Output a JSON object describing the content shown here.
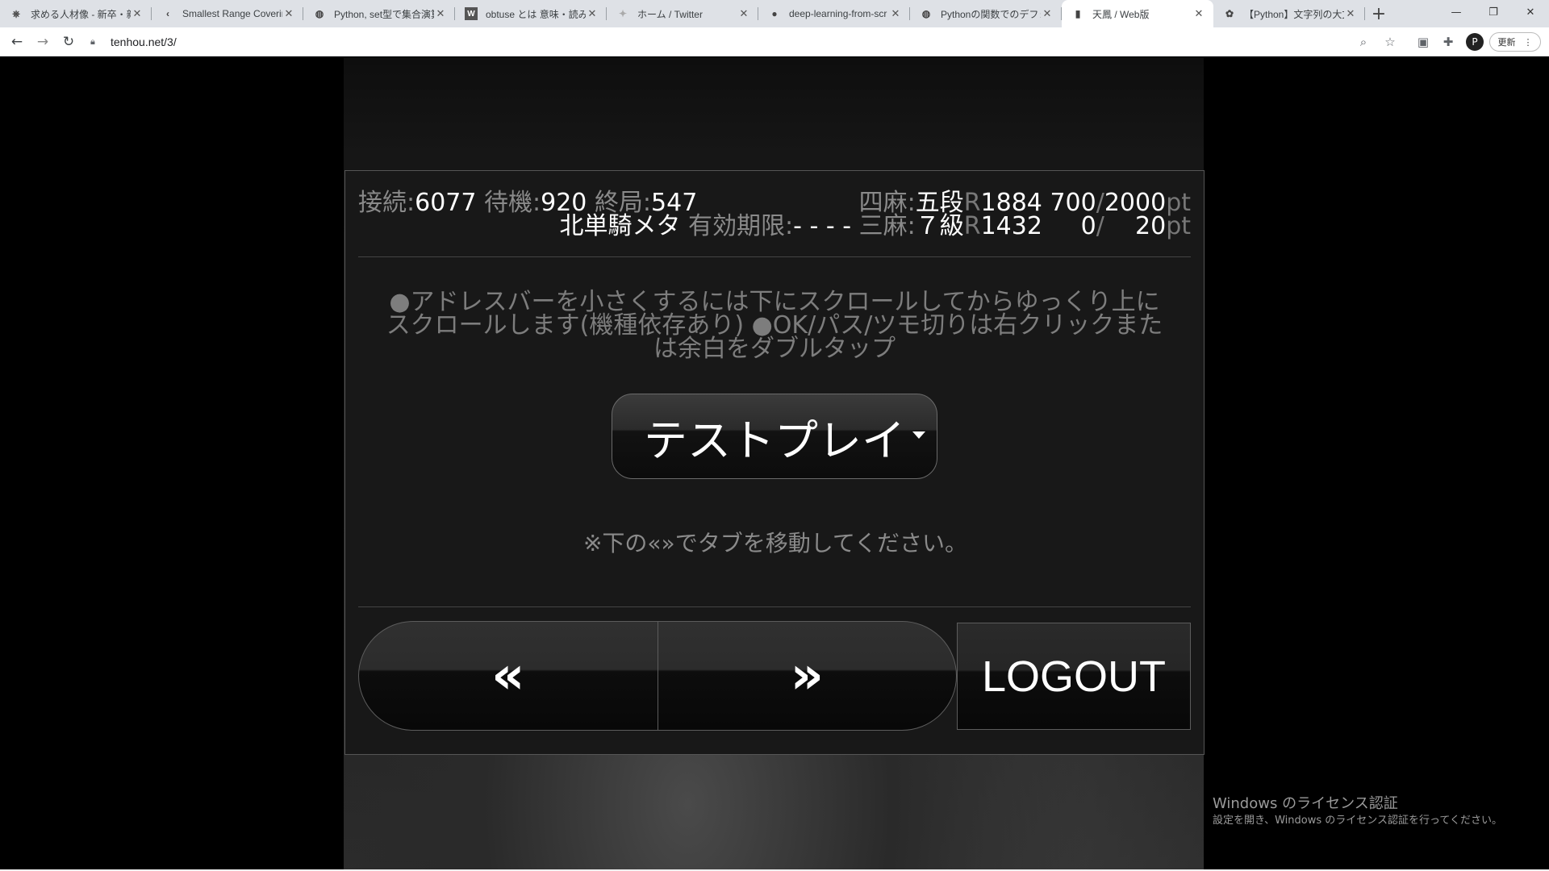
{
  "browser": {
    "tabs": [
      {
        "title": "求める人材像 - 新卒・新",
        "icon": "helm-icon"
      },
      {
        "title": "Smallest Range Coverin",
        "icon": "leetcode-icon"
      },
      {
        "title": "Python, set型で集合演算",
        "icon": "globe-icon"
      },
      {
        "title": "obtuse とは 意味・読み方",
        "icon": "weblio-icon"
      },
      {
        "title": "ホーム / Twitter",
        "icon": "twitter-icon"
      },
      {
        "title": "deep-learning-from-scr",
        "icon": "github-icon"
      },
      {
        "title": "Pythonの関数でのデフォル",
        "icon": "globe-icon"
      },
      {
        "title": "天鳳 / Web版",
        "icon": "tenhou-icon",
        "active": true
      },
      {
        "title": "【Python】文字列の大文",
        "icon": "openai-icon"
      }
    ],
    "new_tab": "+",
    "url": "tenhou.net/3/",
    "update_label": "更新",
    "avatar_letter": "P"
  },
  "stats": {
    "connect_label": "接続:",
    "connect_value": "6077",
    "waiting_label": "待機:",
    "waiting_value": "920",
    "finished_label": "終局:",
    "finished_value": "547",
    "username": "北単騎メタ",
    "expiry_label": "有効期限:",
    "expiry_value": "- - - -",
    "yonma_label": "四麻:",
    "yonma_rank": "五段",
    "yonma_r": "R",
    "yonma_rating": "1884",
    "yonma_points": "700",
    "yonma_slash": "/",
    "yonma_max": "2000",
    "yonma_unit": "pt",
    "sanma_label": "三麻:",
    "sanma_rank": "７級",
    "sanma_r": "R",
    "sanma_rating": "1432",
    "sanma_points": "0",
    "sanma_slash": "/",
    "sanma_max": "20",
    "sanma_unit": "pt"
  },
  "notice_text": "●アドレスバーを小さくするには下にスクロールしてからゆっくり上にスクロールします(機種依存あり) ●OK/パス/ツモ切りは右クリックまたは余白をダブルタップ",
  "play_button_label": "テストプレイ",
  "hint_text": "※下の«»でタブを移動してください。",
  "nav": {
    "prev": "«",
    "next": "»"
  },
  "logout_label": "LOGOUT",
  "watermark": {
    "title": "Windows のライセンス認証",
    "subtitle": "設定を開き、Windows のライセンス認証を行ってください。"
  }
}
